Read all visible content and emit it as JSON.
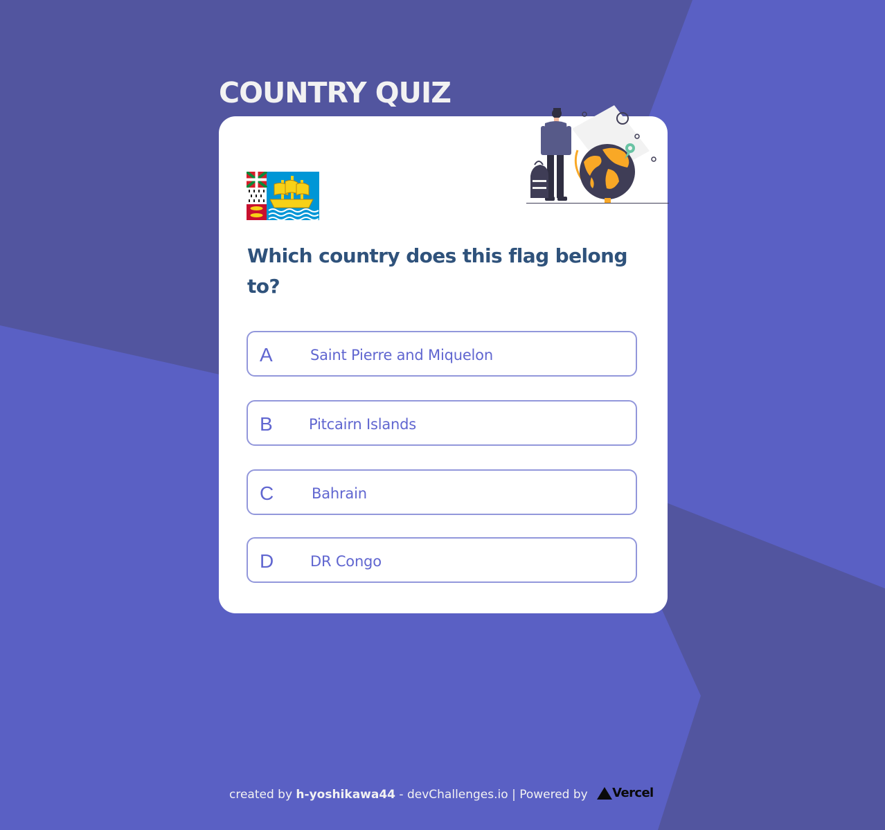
{
  "colors": {
    "background": "#5a60c4",
    "background_dark": "#52559f",
    "card": "#ffffff",
    "title": "#f2f2f2",
    "question": "#2f527b",
    "option_text": "#6066d0",
    "option_border": "#9297db"
  },
  "app": {
    "title": "COUNTRY QUIZ",
    "illustration_icon": "traveler-globe-illustration"
  },
  "question": {
    "flag_icon": "flag-saint-pierre-and-miquelon",
    "text": "Which country does this flag belong to?"
  },
  "options": [
    {
      "letter": "A",
      "text": "Saint Pierre and Miquelon"
    },
    {
      "letter": "B",
      "text": "Pitcairn Islands"
    },
    {
      "letter": "C",
      "text": "Bahrain"
    },
    {
      "letter": "D",
      "text": "DR Congo"
    }
  ],
  "footer": {
    "created_by": "created by",
    "author": "h-yoshikawa44",
    "separator1": "-",
    "site": "devChallenges.io",
    "separator2": "|",
    "powered_by": "Powered by",
    "vercel_label": "Vercel",
    "vercel_icon": "vercel-triangle-icon"
  }
}
